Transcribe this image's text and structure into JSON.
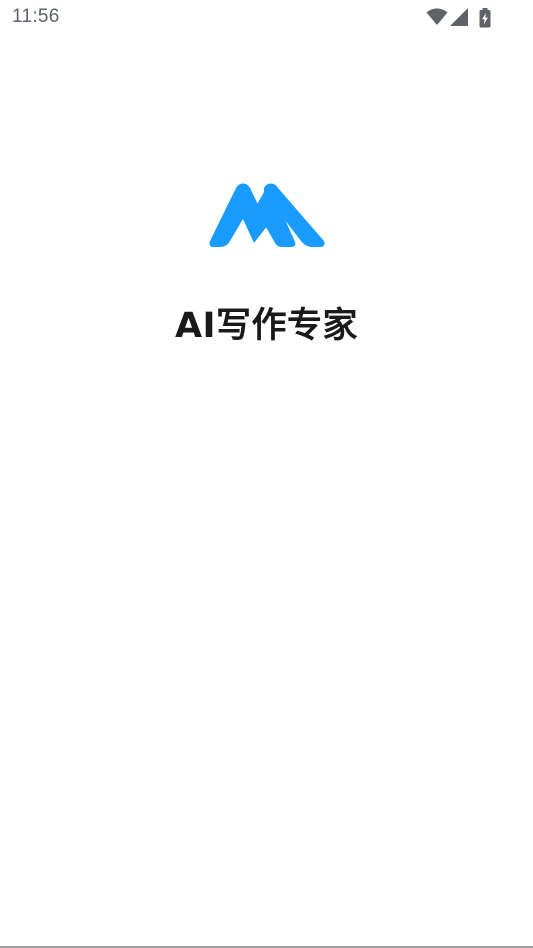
{
  "status_bar": {
    "time": "11:56",
    "icons": [
      "wifi-icon",
      "cellular-signal-icon",
      "battery-charging-icon"
    ]
  },
  "splash": {
    "logo": "app-logo-icon",
    "title": "AI写作专家"
  },
  "colors": {
    "logo_blue": "#1a9bff",
    "title_text": "#1a1a1a",
    "status_icons": "#5f6368",
    "background": "#ffffff"
  }
}
